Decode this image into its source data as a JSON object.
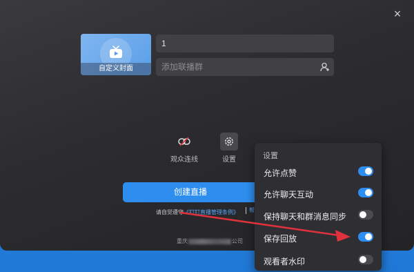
{
  "dialog": {
    "close_symbol": "×",
    "cover_label": "自定义封面",
    "title_value": "1",
    "group_placeholder": "添加联播群",
    "toolbar": {
      "audience_label": "观众连线",
      "settings_label": "设置"
    },
    "create_button": "创建直播",
    "agreement": {
      "prefix": "请自觉遵守",
      "link": "《钉钉直播管理条例》",
      "suffix_link": "帮"
    },
    "org": {
      "prefix": "重庆",
      "suffix": "公司"
    }
  },
  "settings_menu": {
    "title": "设置",
    "items": [
      {
        "label": "允许点赞",
        "enabled": true
      },
      {
        "label": "允许聊天互动",
        "enabled": true
      },
      {
        "label": "保持聊天和群消息同步",
        "enabled": false
      },
      {
        "label": "保存回放",
        "enabled": true
      },
      {
        "label": "观看者水印",
        "enabled": false
      }
    ]
  },
  "colors": {
    "accent": "#2e8ef0",
    "annotation_arrow": "#e0323c",
    "background_blue": "#1f78d6"
  }
}
